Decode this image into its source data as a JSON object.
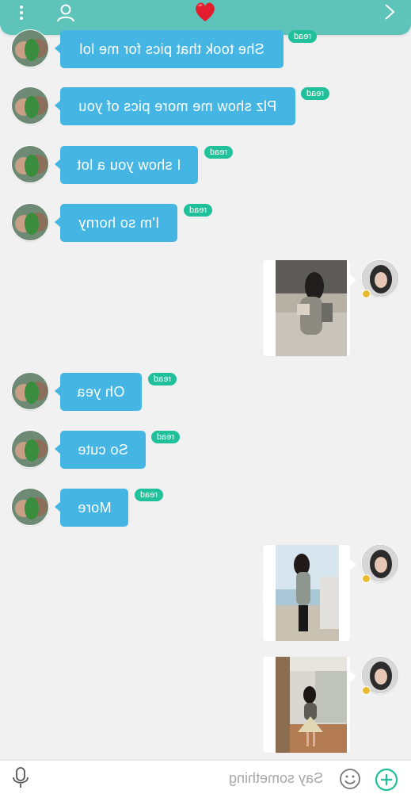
{
  "header": {
    "menu_icon": "more-vertical-icon",
    "profile_icon": "person-icon",
    "favorite_icon": "heart-icon",
    "forward_icon": "chevron-right-icon",
    "colors": {
      "bar": "#5ec3b8",
      "heart": "#e21d2d"
    }
  },
  "messages": [
    {
      "type": "text",
      "side": "left",
      "text": "She took that pics for me lol",
      "status": "read"
    },
    {
      "type": "text",
      "side": "left",
      "text": "Plz show me more pics of you",
      "status": "read"
    },
    {
      "type": "text",
      "side": "left",
      "text": "I show you a lot",
      "status": "read"
    },
    {
      "type": "text",
      "side": "left",
      "text": "I'm so horny",
      "status": "read"
    },
    {
      "type": "image",
      "side": "right"
    },
    {
      "type": "text",
      "side": "left",
      "text": "Oh yea",
      "status": "read"
    },
    {
      "type": "text",
      "side": "left",
      "text": "So cute",
      "status": "read"
    },
    {
      "type": "text",
      "side": "left",
      "text": "More",
      "status": "read"
    },
    {
      "type": "image",
      "side": "right"
    },
    {
      "type": "image",
      "side": "right"
    }
  ],
  "input": {
    "placeholder": "Say something",
    "mic_icon": "microphone-icon",
    "emoji_icon": "smiley-icon",
    "add_icon": "plus-circle-icon",
    "colors": {
      "bubble": "#45b6e3",
      "read_badge": "#1fc09a",
      "add": "#1fc09a"
    }
  }
}
